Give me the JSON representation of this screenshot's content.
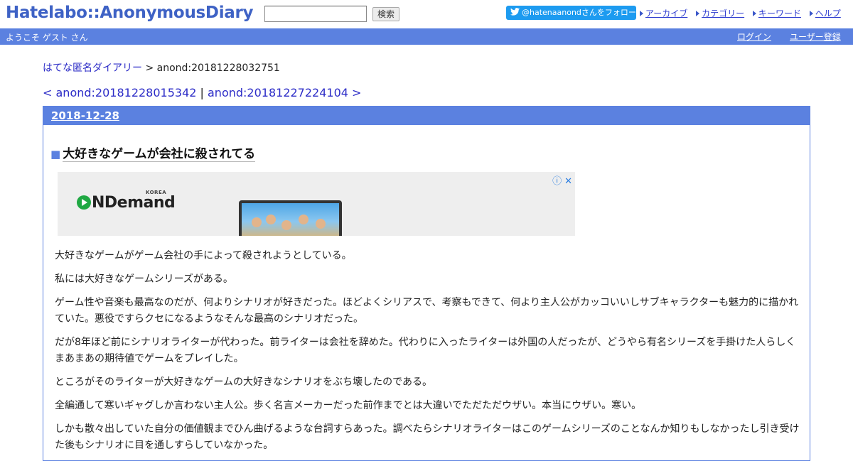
{
  "header": {
    "logo": "Hatelabo::AnonymousDiary",
    "search_button": "検索",
    "twitter_follow": "@hatenaanondさんをフォロー",
    "links": [
      "アーカイブ",
      "カテゴリー",
      "キーワード",
      "ヘルプ"
    ]
  },
  "bar": {
    "welcome": "ようこそ ゲスト さん",
    "login": "ログイン",
    "register": "ユーザー登録"
  },
  "breadcrumb": {
    "home": "はてな匿名ダイアリー",
    "separator": " > ",
    "current": "anond:20181228032751"
  },
  "pager": {
    "prev": "< anond:20181228015342",
    "separator": " | ",
    "next": "anond:20181227224104 >"
  },
  "day": {
    "date": "2018-12-28",
    "title_mark": "■",
    "title": "大好きなゲームが会社に殺されてる"
  },
  "ad": {
    "brand": "NDemand",
    "brand_prefix": "O",
    "region": "KOREA",
    "info_icon": "ⓘ",
    "close_icon": "✕"
  },
  "paragraphs": [
    "大好きなゲームがゲーム会社の手によって殺されようとしている。",
    "私には大好きなゲームシリーズがある。",
    "ゲーム性や音楽も最高なのだが、何よりシナリオが好きだった。ほどよくシリアスで、考察もできて、何より主人公がカッコいいしサブキャラクターも魅力的に描かれていた。悪役ですらクセになるようなそんな最高のシナリオだった。",
    "だが8年ほど前にシナリオライターが代わった。前ライターは会社を辞めた。代わりに入ったライターは外国の人だったが、どうやら有名シリーズを手掛けた人らしくまあまあの期待値でゲームをプレイした。",
    "ところがそのライターが大好きなゲームの大好きなシナリオをぶち壊したのである。",
    "全編通して寒いギャグしか言わない主人公。歩く名言メーカーだった前作までとは大違いでただただウザい。本当にウザい。寒い。",
    "しかも散々出していた自分の価値観までひん曲げるような台詞すらあった。調べたらシナリオライターはこのゲームシリーズのことなんか知りもしなかったし引き受けた後もシナリオに目を通しすらしていなかった。"
  ]
}
